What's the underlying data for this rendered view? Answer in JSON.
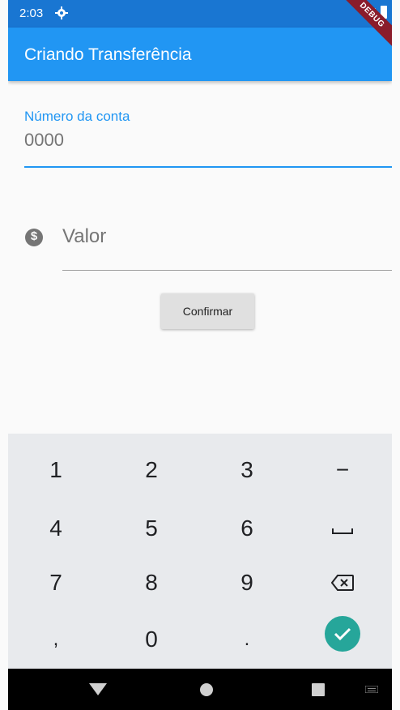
{
  "status_bar": {
    "time": "2:03"
  },
  "debug_banner": "DEBUG",
  "app_bar": {
    "title": "Criando Transferência"
  },
  "form": {
    "account_field": {
      "label": "Número da conta",
      "value": "0000"
    },
    "value_field": {
      "placeholder": "Valor"
    },
    "confirm_label": "Confirmar"
  },
  "keyboard": {
    "rows": [
      [
        "1",
        "2",
        "3",
        "−"
      ],
      [
        "4",
        "5",
        "6",
        "space-icon"
      ],
      [
        "7",
        "8",
        "9",
        "backspace-icon"
      ],
      [
        ",",
        "0",
        ".",
        "enter-check-icon"
      ]
    ],
    "labels": {
      "k1": "1",
      "k2": "2",
      "k3": "3",
      "minus": "−",
      "k4": "4",
      "k5": "5",
      "k6": "6",
      "k7": "7",
      "k8": "8",
      "k9": "9",
      "comma": ",",
      "k0": "0",
      "dot": "."
    },
    "accent_color": "#26a69a"
  },
  "colors": {
    "primary": "#2196f3",
    "status": "#1976d2",
    "debug": "#8a1c2b"
  }
}
